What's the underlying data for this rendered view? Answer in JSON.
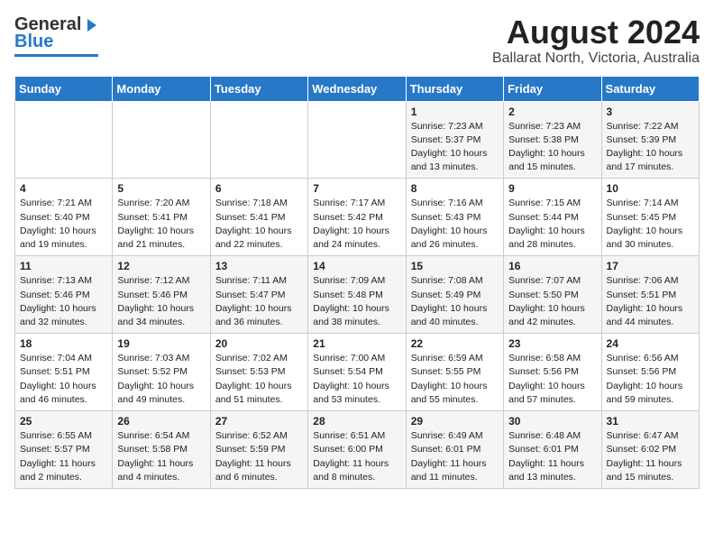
{
  "header": {
    "logo_general": "General",
    "logo_blue": "Blue",
    "title": "August 2024",
    "subtitle": "Ballarat North, Victoria, Australia"
  },
  "calendar": {
    "days_of_week": [
      "Sunday",
      "Monday",
      "Tuesday",
      "Wednesday",
      "Thursday",
      "Friday",
      "Saturday"
    ],
    "weeks": [
      [
        {
          "day": "",
          "info": ""
        },
        {
          "day": "",
          "info": ""
        },
        {
          "day": "",
          "info": ""
        },
        {
          "day": "",
          "info": ""
        },
        {
          "day": "1",
          "info": "Sunrise: 7:23 AM\nSunset: 5:37 PM\nDaylight: 10 hours\nand 13 minutes."
        },
        {
          "day": "2",
          "info": "Sunrise: 7:23 AM\nSunset: 5:38 PM\nDaylight: 10 hours\nand 15 minutes."
        },
        {
          "day": "3",
          "info": "Sunrise: 7:22 AM\nSunset: 5:39 PM\nDaylight: 10 hours\nand 17 minutes."
        }
      ],
      [
        {
          "day": "4",
          "info": "Sunrise: 7:21 AM\nSunset: 5:40 PM\nDaylight: 10 hours\nand 19 minutes."
        },
        {
          "day": "5",
          "info": "Sunrise: 7:20 AM\nSunset: 5:41 PM\nDaylight: 10 hours\nand 21 minutes."
        },
        {
          "day": "6",
          "info": "Sunrise: 7:18 AM\nSunset: 5:41 PM\nDaylight: 10 hours\nand 22 minutes."
        },
        {
          "day": "7",
          "info": "Sunrise: 7:17 AM\nSunset: 5:42 PM\nDaylight: 10 hours\nand 24 minutes."
        },
        {
          "day": "8",
          "info": "Sunrise: 7:16 AM\nSunset: 5:43 PM\nDaylight: 10 hours\nand 26 minutes."
        },
        {
          "day": "9",
          "info": "Sunrise: 7:15 AM\nSunset: 5:44 PM\nDaylight: 10 hours\nand 28 minutes."
        },
        {
          "day": "10",
          "info": "Sunrise: 7:14 AM\nSunset: 5:45 PM\nDaylight: 10 hours\nand 30 minutes."
        }
      ],
      [
        {
          "day": "11",
          "info": "Sunrise: 7:13 AM\nSunset: 5:46 PM\nDaylight: 10 hours\nand 32 minutes."
        },
        {
          "day": "12",
          "info": "Sunrise: 7:12 AM\nSunset: 5:46 PM\nDaylight: 10 hours\nand 34 minutes."
        },
        {
          "day": "13",
          "info": "Sunrise: 7:11 AM\nSunset: 5:47 PM\nDaylight: 10 hours\nand 36 minutes."
        },
        {
          "day": "14",
          "info": "Sunrise: 7:09 AM\nSunset: 5:48 PM\nDaylight: 10 hours\nand 38 minutes."
        },
        {
          "day": "15",
          "info": "Sunrise: 7:08 AM\nSunset: 5:49 PM\nDaylight: 10 hours\nand 40 minutes."
        },
        {
          "day": "16",
          "info": "Sunrise: 7:07 AM\nSunset: 5:50 PM\nDaylight: 10 hours\nand 42 minutes."
        },
        {
          "day": "17",
          "info": "Sunrise: 7:06 AM\nSunset: 5:51 PM\nDaylight: 10 hours\nand 44 minutes."
        }
      ],
      [
        {
          "day": "18",
          "info": "Sunrise: 7:04 AM\nSunset: 5:51 PM\nDaylight: 10 hours\nand 46 minutes."
        },
        {
          "day": "19",
          "info": "Sunrise: 7:03 AM\nSunset: 5:52 PM\nDaylight: 10 hours\nand 49 minutes."
        },
        {
          "day": "20",
          "info": "Sunrise: 7:02 AM\nSunset: 5:53 PM\nDaylight: 10 hours\nand 51 minutes."
        },
        {
          "day": "21",
          "info": "Sunrise: 7:00 AM\nSunset: 5:54 PM\nDaylight: 10 hours\nand 53 minutes."
        },
        {
          "day": "22",
          "info": "Sunrise: 6:59 AM\nSunset: 5:55 PM\nDaylight: 10 hours\nand 55 minutes."
        },
        {
          "day": "23",
          "info": "Sunrise: 6:58 AM\nSunset: 5:56 PM\nDaylight: 10 hours\nand 57 minutes."
        },
        {
          "day": "24",
          "info": "Sunrise: 6:56 AM\nSunset: 5:56 PM\nDaylight: 10 hours\nand 59 minutes."
        }
      ],
      [
        {
          "day": "25",
          "info": "Sunrise: 6:55 AM\nSunset: 5:57 PM\nDaylight: 11 hours\nand 2 minutes."
        },
        {
          "day": "26",
          "info": "Sunrise: 6:54 AM\nSunset: 5:58 PM\nDaylight: 11 hours\nand 4 minutes."
        },
        {
          "day": "27",
          "info": "Sunrise: 6:52 AM\nSunset: 5:59 PM\nDaylight: 11 hours\nand 6 minutes."
        },
        {
          "day": "28",
          "info": "Sunrise: 6:51 AM\nSunset: 6:00 PM\nDaylight: 11 hours\nand 8 minutes."
        },
        {
          "day": "29",
          "info": "Sunrise: 6:49 AM\nSunset: 6:01 PM\nDaylight: 11 hours\nand 11 minutes."
        },
        {
          "day": "30",
          "info": "Sunrise: 6:48 AM\nSunset: 6:01 PM\nDaylight: 11 hours\nand 13 minutes."
        },
        {
          "day": "31",
          "info": "Sunrise: 6:47 AM\nSunset: 6:02 PM\nDaylight: 11 hours\nand 15 minutes."
        }
      ]
    ]
  }
}
